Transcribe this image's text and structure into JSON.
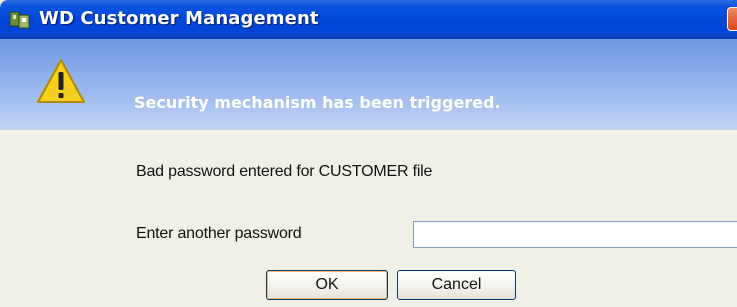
{
  "window": {
    "title": "WD Customer Management"
  },
  "banner": {
    "message": "Security mechanism has been triggered."
  },
  "dialog": {
    "message": "Bad password entered for CUSTOMER file",
    "password_label": "Enter another password",
    "password_value": "",
    "ok_label": "OK",
    "cancel_label": "Cancel"
  },
  "icons": {
    "app": "app-icon",
    "warning": "warning-icon",
    "close": "close-icon"
  },
  "colors": {
    "titlebar": "#0047d6",
    "banner": "#8aacea",
    "warning_fill": "#f5d020"
  }
}
